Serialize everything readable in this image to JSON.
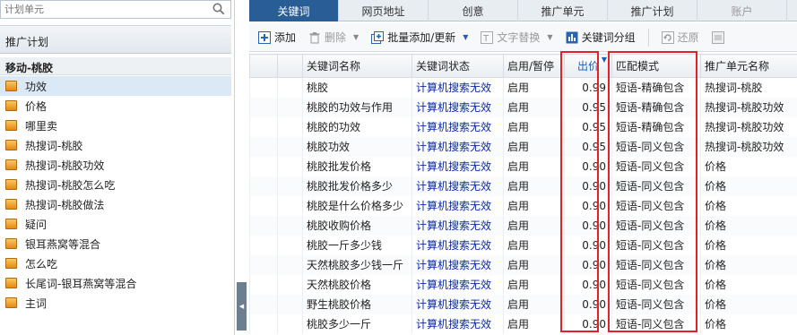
{
  "search": {
    "placeholder": "计划单元"
  },
  "left": {
    "section_title": "推广计划",
    "plan_name": "移动-桃胶",
    "units": [
      "功效",
      "价格",
      "哪里卖",
      "热搜词-桃胶",
      "热搜词-桃胶功效",
      "热搜词-桃胶怎么吃",
      "热搜词-桃胶做法",
      "疑问",
      "银耳燕窝等混合",
      "怎么吃",
      "长尾词-银耳燕窝等混合",
      "主词"
    ],
    "selected_index": 0
  },
  "tabs": [
    {
      "label": "关键词",
      "state": "active"
    },
    {
      "label": "网页地址",
      "state": "normal"
    },
    {
      "label": "创意",
      "state": "normal"
    },
    {
      "label": "推广单元",
      "state": "normal"
    },
    {
      "label": "推广计划",
      "state": "normal"
    },
    {
      "label": "账户",
      "state": "disabled"
    }
  ],
  "toolbar": {
    "add": "添加",
    "delete": "删除",
    "bulk": "批量添加/更新",
    "replace": "文字替换",
    "group": "关键词分组",
    "restore": "还原"
  },
  "table": {
    "headers": [
      "关键词名称",
      "关键词状态",
      "启用/暂停",
      "出价",
      "匹配模式",
      "推广单元名称"
    ],
    "rows": [
      {
        "name": "桃胶",
        "status": "计算机搜索无效",
        "enabled": "启用",
        "bid": "0.99",
        "match": "短语-精确包含",
        "unit": "热搜词-桃胶"
      },
      {
        "name": "桃胶的功效与作用",
        "status": "计算机搜索无效",
        "enabled": "启用",
        "bid": "0.95",
        "match": "短语-精确包含",
        "unit": "热搜词-桃胶功效"
      },
      {
        "name": "桃胶的功效",
        "status": "计算机搜索无效",
        "enabled": "启用",
        "bid": "0.95",
        "match": "短语-精确包含",
        "unit": "热搜词-桃胶功效"
      },
      {
        "name": "桃胶功效",
        "status": "计算机搜索无效",
        "enabled": "启用",
        "bid": "0.95",
        "match": "短语-同义包含",
        "unit": "热搜词-桃胶功效"
      },
      {
        "name": "桃胶批发价格",
        "status": "计算机搜索无效",
        "enabled": "启用",
        "bid": "0.90",
        "match": "短语-同义包含",
        "unit": "价格"
      },
      {
        "name": "桃胶批发价格多少",
        "status": "计算机搜索无效",
        "enabled": "启用",
        "bid": "0.90",
        "match": "短语-同义包含",
        "unit": "价格"
      },
      {
        "name": "桃胶是什么价格多少",
        "status": "计算机搜索无效",
        "enabled": "启用",
        "bid": "0.90",
        "match": "短语-同义包含",
        "unit": "价格"
      },
      {
        "name": "桃胶收购价格",
        "status": "计算机搜索无效",
        "enabled": "启用",
        "bid": "0.90",
        "match": "短语-同义包含",
        "unit": "价格"
      },
      {
        "name": "桃胶一斤多少钱",
        "status": "计算机搜索无效",
        "enabled": "启用",
        "bid": "0.90",
        "match": "短语-同义包含",
        "unit": "价格"
      },
      {
        "name": "天然桃胶多少钱一斤",
        "status": "计算机搜索无效",
        "enabled": "启用",
        "bid": "0.90",
        "match": "短语-同义包含",
        "unit": "价格"
      },
      {
        "name": "天然桃胶价格",
        "status": "计算机搜索无效",
        "enabled": "启用",
        "bid": "0.90",
        "match": "短语-同义包含",
        "unit": "价格"
      },
      {
        "name": "野生桃胶价格",
        "status": "计算机搜索无效",
        "enabled": "启用",
        "bid": "0.90",
        "match": "短语-同义包含",
        "unit": "价格"
      },
      {
        "name": "桃胶多少一斤",
        "status": "计算机搜索无效",
        "enabled": "启用",
        "bid": "0.90",
        "match": "短语-同义包含",
        "unit": "价格"
      }
    ]
  },
  "colors": {
    "active_tab": "#295d95",
    "status_text": "#0a2a9e",
    "highlight": "#e0222a"
  }
}
